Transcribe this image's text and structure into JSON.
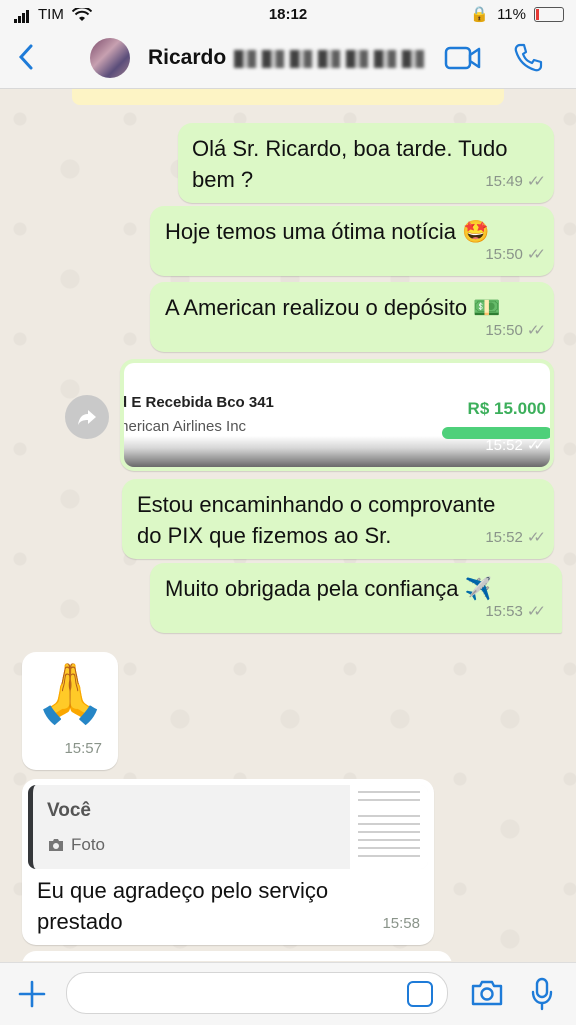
{
  "status_bar": {
    "carrier": "TIM",
    "time": "18:12",
    "battery": "11%"
  },
  "header": {
    "back_icon": "chevron-left-icon",
    "contact_name": "Ricardo"
  },
  "messages": [
    {
      "text_line1": "Olá Sr. Ricardo, boa tarde. Tudo",
      "text_line2": "bem ?",
      "time": "15:49"
    },
    {
      "text": "Hoje temos uma ótima notícia 🤩",
      "time": "15:50"
    },
    {
      "text": "A American realizou o depósito 💵",
      "time": "15:50"
    },
    {
      "image": {
        "title": "d E Recebida Bco 341",
        "subtitle": "merican Airlines Inc",
        "amount": "R$ 15.000"
      },
      "time": "15:52"
    },
    {
      "text_line1": "Estou encaminhando o comprovante",
      "text_line2": "do PIX que fizemos ao Sr.",
      "time": "15:52"
    },
    {
      "text": "Muito obrigada pela confiança ✈️",
      "time": "15:53"
    },
    {
      "emoji": "🙏",
      "time": "15:57"
    },
    {
      "quote_author": "Você",
      "quote_type": "Foto",
      "text_line1": "Eu que agradeço pelo serviço",
      "text_line2": "prestado",
      "time": "15:58"
    }
  ],
  "colors": {
    "outgoing": "#dcf8c6",
    "incoming": "#ffffff",
    "accent": "#1e7bd8",
    "background": "#efeae2"
  }
}
